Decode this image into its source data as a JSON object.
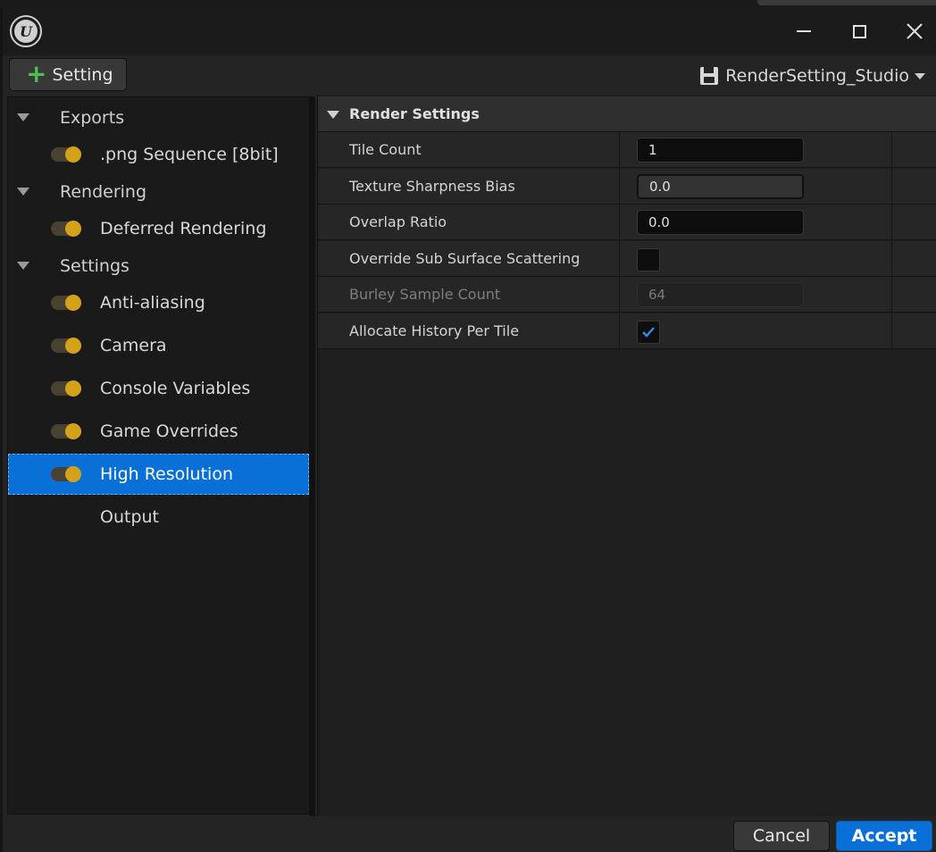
{
  "window": {
    "logo_icon": "unreal-engine-logo-icon",
    "controls": [
      "minimize-icon",
      "maximize-icon",
      "close-icon"
    ]
  },
  "toolbar": {
    "add_setting_label": "Setting",
    "preset_name": "RenderSetting_Studio"
  },
  "sidebar": {
    "categories": [
      {
        "label": "Exports",
        "items": [
          {
            "label": ".png Sequence [8bit]",
            "enabled": true
          }
        ]
      },
      {
        "label": "Rendering",
        "items": [
          {
            "label": "Deferred Rendering",
            "enabled": true
          }
        ]
      },
      {
        "label": "Settings",
        "items": [
          {
            "label": "Anti-aliasing",
            "enabled": true
          },
          {
            "label": "Camera",
            "enabled": true
          },
          {
            "label": "Console Variables",
            "enabled": true
          },
          {
            "label": "Game Overrides",
            "enabled": true
          },
          {
            "label": "High Resolution",
            "enabled": true,
            "selected": true
          },
          {
            "label": "Output"
          }
        ]
      }
    ]
  },
  "details": {
    "section_title": "Render Settings",
    "properties": [
      {
        "name": "Tile Count",
        "type": "number",
        "value": "1"
      },
      {
        "name": "Texture Sharpness Bias",
        "type": "number",
        "value": "0.0"
      },
      {
        "name": "Overlap Ratio",
        "type": "number",
        "value": "0.0"
      },
      {
        "name": "Override Sub Surface Scattering",
        "type": "checkbox",
        "checked": false
      },
      {
        "name": "Burley Sample Count",
        "type": "number",
        "value": "64",
        "disabled": true
      },
      {
        "name": "Allocate History Per Tile",
        "type": "checkbox",
        "checked": true
      }
    ]
  },
  "footer": {
    "cancel_label": "Cancel",
    "accept_label": "Accept"
  },
  "colors": {
    "accent": "#0870d6",
    "toggle_on": "#d3a11a",
    "add_icon": "#4fbf4f"
  }
}
